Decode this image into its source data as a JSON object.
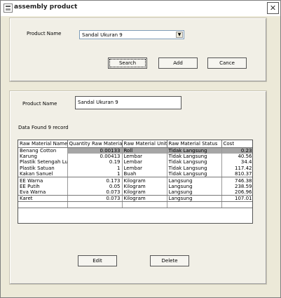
{
  "window": {
    "title": "assembly product",
    "close_label": "✕"
  },
  "search_panel": {
    "product_name_label": "Product Name",
    "product_name_selected": "Sandal Ukuran 9",
    "search_label": "Search",
    "add_label": "Add",
    "cancel_label": "Cance"
  },
  "detail_panel": {
    "product_name_label": "Product Name",
    "product_name_value": "Sandal Ukuran 9",
    "data_found_text": "Data Found 9 record"
  },
  "table": {
    "headers": [
      "Raw Material Name",
      "Quantity Raw Material",
      "Raw Material Unit",
      "Raw Material Status",
      "Cost"
    ],
    "rows": [
      [
        "Benang Cotton",
        "0.00133",
        "Roll",
        "Tidak Langsung",
        "0.23"
      ],
      [
        "Karung",
        "0.00413",
        "Lembar",
        "Tidak Langsung",
        "40.56"
      ],
      [
        "Plastik Setengah Lu",
        "0.19",
        "Lembar",
        "Tidak Langsung",
        "34.4"
      ],
      [
        "Plastik Satuan",
        "1",
        "Lembar",
        "Tidak Langsung",
        "117.42"
      ],
      [
        "Kakan Sanuel",
        "1",
        "Buah",
        "Tidak Langsung",
        "810.37"
      ],
      [
        "EE Warna",
        "0.173",
        "Kilogram",
        "Langsung",
        "746.38"
      ],
      [
        "EE Putih",
        "0.05",
        "Kilogram",
        "Langsung",
        "238.59"
      ],
      [
        "Eva Warna",
        "0.073",
        "Kilogram",
        "Langsung",
        "206.96"
      ],
      [
        "Karet",
        "0.073",
        "Kilogram",
        "Langsung",
        "107.01"
      ]
    ]
  },
  "actions": {
    "edit_label": "Edit",
    "delete_label": "Delete"
  },
  "colors": {
    "background": "#ece9d8",
    "selection": "#a6a6a6"
  }
}
